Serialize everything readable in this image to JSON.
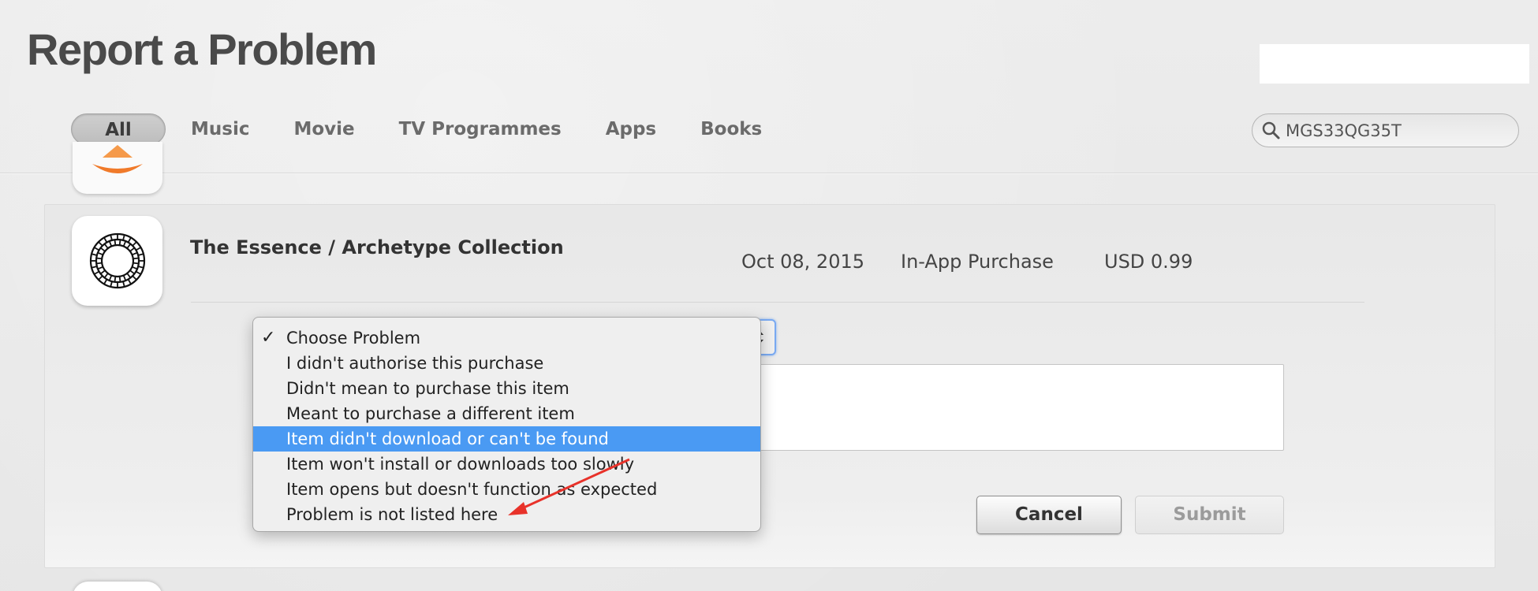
{
  "page": {
    "title": "Report a Problem"
  },
  "tabs": [
    {
      "label": "All",
      "active": true
    },
    {
      "label": "Music"
    },
    {
      "label": "Movie"
    },
    {
      "label": "TV Programmes"
    },
    {
      "label": "Apps"
    },
    {
      "label": "Books"
    }
  ],
  "search": {
    "value": "MGS33QG35T",
    "icon": "search-icon"
  },
  "item": {
    "title": "The Essence / Archetype Collection",
    "date": "Oct 08, 2015",
    "type": "In-App Purchase",
    "price": "USD 0.99"
  },
  "problem_menu": {
    "checkmark": "✓",
    "options": [
      "Choose Problem",
      "I didn't authorise this purchase",
      "Didn't mean to purchase this item",
      "Meant to purchase a different item",
      "Item didn't download or can't be found",
      "Item won't install or downloads too slowly",
      "Item opens but doesn't function as expected",
      "Problem is not listed here"
    ],
    "checked_index": 0,
    "highlighted_index": 4
  },
  "buttons": {
    "cancel": "Cancel",
    "submit": "Submit"
  },
  "colors": {
    "highlight": "#4a9af3",
    "annotation_arrow": "#e8322a"
  }
}
